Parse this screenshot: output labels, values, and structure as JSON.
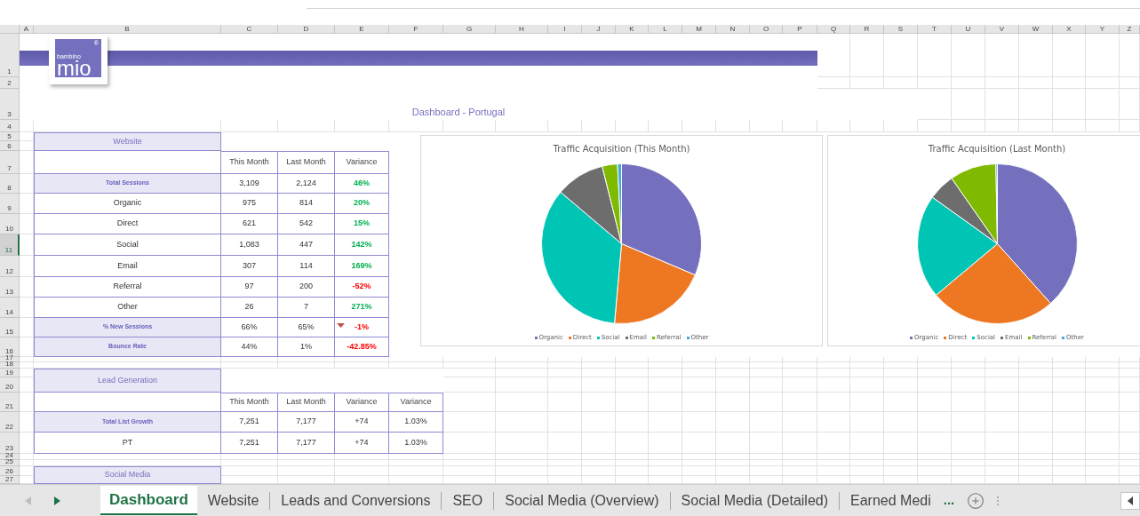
{
  "sheet": {
    "columns": [
      "A",
      "B",
      "C",
      "D",
      "E",
      "F",
      "G",
      "H",
      "I",
      "J",
      "K",
      "L",
      "M",
      "N",
      "O",
      "P",
      "Q",
      "R",
      "S",
      "T",
      "U",
      "V",
      "W",
      "X",
      "Y",
      "Z"
    ],
    "rows": [
      {
        "label": "1",
        "selected": false
      },
      {
        "label": "2",
        "selected": false
      },
      {
        "label": "3",
        "selected": false
      },
      {
        "label": "4",
        "selected": false
      },
      {
        "label": "5",
        "selected": false
      },
      {
        "label": "6",
        "selected": false
      },
      {
        "label": "7",
        "selected": false
      },
      {
        "label": "8",
        "selected": false
      },
      {
        "label": "9",
        "selected": false
      },
      {
        "label": "10",
        "selected": false
      },
      {
        "label": "11",
        "selected": true
      },
      {
        "label": "12",
        "selected": false
      },
      {
        "label": "13",
        "selected": false
      },
      {
        "label": "14",
        "selected": false
      },
      {
        "label": "15",
        "selected": false
      },
      {
        "label": "16",
        "selected": false
      },
      {
        "label": "17",
        "selected": false
      },
      {
        "label": "18",
        "selected": false
      },
      {
        "label": "19",
        "selected": false
      },
      {
        "label": "20",
        "selected": false
      },
      {
        "label": "21",
        "selected": false
      },
      {
        "label": "22",
        "selected": false
      },
      {
        "label": "23",
        "selected": false
      },
      {
        "label": "24",
        "selected": false
      },
      {
        "label": "25",
        "selected": false
      },
      {
        "label": "26",
        "selected": false
      },
      {
        "label": "27",
        "selected": false
      }
    ]
  },
  "logo": {
    "small": "bambino",
    "large": "mio",
    "mark": "®"
  },
  "title": "Dashboard - Portugal",
  "website": {
    "title": "Website",
    "headers": [
      "This Month",
      "Last Month",
      "Variance"
    ],
    "rows": [
      {
        "label": "Total Sessions",
        "kind": "total",
        "cells": [
          "3,109",
          "2,124"
        ],
        "variance": {
          "text": "46%",
          "negative": false,
          "flag": false
        }
      },
      {
        "label": "Organic",
        "kind": "normal",
        "cells": [
          "975",
          "814"
        ],
        "variance": {
          "text": "20%",
          "negative": false,
          "flag": false
        }
      },
      {
        "label": "Direct",
        "kind": "normal",
        "cells": [
          "621",
          "542"
        ],
        "variance": {
          "text": "15%",
          "negative": false,
          "flag": false
        }
      },
      {
        "label": "Social",
        "kind": "normal",
        "cells": [
          "1,083",
          "447"
        ],
        "variance": {
          "text": "142%",
          "negative": false,
          "flag": false
        }
      },
      {
        "label": "Email",
        "kind": "normal",
        "cells": [
          "307",
          "114"
        ],
        "variance": {
          "text": "169%",
          "negative": false,
          "flag": false
        }
      },
      {
        "label": "Referral",
        "kind": "normal",
        "cells": [
          "97",
          "200"
        ],
        "variance": {
          "text": "-52%",
          "negative": true,
          "flag": false
        }
      },
      {
        "label": "Other",
        "kind": "normal",
        "cells": [
          "26",
          "7"
        ],
        "variance": {
          "text": "271%",
          "negative": false,
          "flag": false
        }
      },
      {
        "label": "% New Sessions",
        "kind": "total",
        "cells": [
          "66%",
          "65%"
        ],
        "variance": {
          "text": "-1%",
          "negative": true,
          "flag": true
        }
      },
      {
        "label": "Bounce Rate",
        "kind": "total",
        "cells": [
          "44%",
          "1%"
        ],
        "variance": {
          "text": "-42.85%",
          "negative": true,
          "flag": false
        }
      }
    ]
  },
  "lead_generation": {
    "title": "Lead Generation",
    "headers": [
      "This Month",
      "Last Month",
      "Variance",
      "Variance"
    ],
    "rows": [
      {
        "label": "Total List Growth",
        "kind": "total",
        "cells": [
          "7,251",
          "7,177",
          "+74",
          "1.03%"
        ]
      },
      {
        "label": "PT",
        "kind": "normal",
        "cells": [
          "7,251",
          "7,177",
          "+74",
          "1.03%"
        ]
      }
    ]
  },
  "social_media": {
    "title": "Social Media"
  },
  "charts": [
    {
      "chart_data": {
        "type": "pie",
        "title": "Traffic Acquisition (This Month)",
        "categories": [
          "Organic",
          "Direct",
          "Social",
          "Email",
          "Referral",
          "Other"
        ],
        "values": [
          31.4,
          20.0,
          34.8,
          9.9,
          3.1,
          0.8
        ],
        "legend": "bottom",
        "colors": [
          "#7470bd",
          "#ee7722",
          "#00c4b4",
          "#6d6d6d",
          "#7fba00",
          "#3fa9e0"
        ]
      }
    },
    {
      "chart_data": {
        "type": "pie",
        "title": "Traffic Acquisition (Last Month)",
        "categories": [
          "Organic",
          "Direct",
          "Social",
          "Email",
          "Referral",
          "Other"
        ],
        "values": [
          38.4,
          25.5,
          21.0,
          5.4,
          9.4,
          0.3
        ],
        "legend": "bottom",
        "colors": [
          "#7470bd",
          "#ee7722",
          "#00c4b4",
          "#6d6d6d",
          "#7fba00",
          "#3fa9e0"
        ]
      }
    }
  ],
  "tabs": {
    "items": [
      {
        "label": "Dashboard",
        "selected": true
      },
      {
        "label": "Website",
        "selected": false
      },
      {
        "label": "Leads and Conversions",
        "selected": false
      },
      {
        "label": "SEO",
        "selected": false
      },
      {
        "label": "Social Media (Overview)",
        "selected": false
      },
      {
        "label": "Social Media (Detailed)",
        "selected": false
      },
      {
        "label": "Earned Medi",
        "selected": false
      }
    ],
    "more": "..."
  }
}
